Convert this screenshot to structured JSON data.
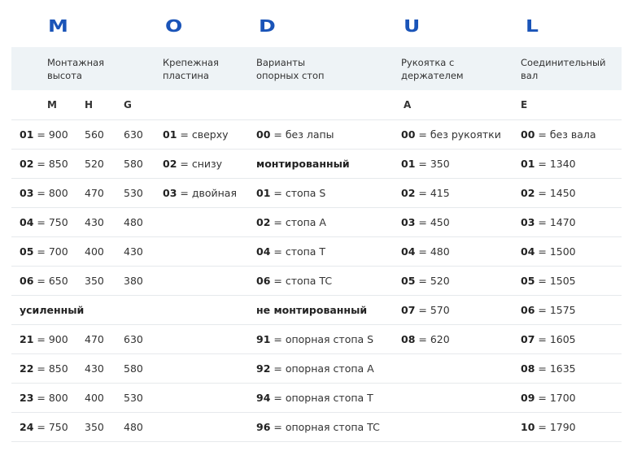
{
  "brand": {
    "letters": [
      "M",
      "O",
      "D",
      "U",
      "L"
    ],
    "color": "#1a54b8"
  },
  "headers": {
    "col1": "Монтажная высота",
    "col2": "Крепежная пластина",
    "col3": "Варианты опорных стоп",
    "col4": "Рукоятка с держателем",
    "col5": "Соединительный вал"
  },
  "subheaders": {
    "m": "M",
    "h": "H",
    "g": "G",
    "a": "A",
    "e": "E"
  },
  "rows": [
    {
      "c1": {
        "code": "01",
        "val": " = 900"
      },
      "h": "560",
      "g": "630",
      "c2": {
        "code": "01",
        "val": " = сверху"
      },
      "c3": {
        "code": "00",
        "val": " = без лапы"
      },
      "c4": {
        "code": "00",
        "val": " = без рукоятки"
      },
      "c5": {
        "code": "00",
        "val": " = без вала"
      }
    },
    {
      "c1": {
        "code": "02",
        "val": " = 850"
      },
      "h": "520",
      "g": "580",
      "c2": {
        "code": "02",
        "val": " = снизу"
      },
      "c3": {
        "code": "монтированный",
        "val": ""
      },
      "c4": {
        "code": "01",
        "val": " = 350"
      },
      "c5": {
        "code": "01",
        "val": " = 1340"
      }
    },
    {
      "c1": {
        "code": "03",
        "val": " = 800"
      },
      "h": "470",
      "g": "530",
      "c2": {
        "code": "03",
        "val": " = двойная"
      },
      "c3": {
        "code": "01",
        "val": " = стопа S"
      },
      "c4": {
        "code": "02",
        "val": " = 415"
      },
      "c5": {
        "code": "02",
        "val": " = 1450"
      }
    },
    {
      "c1": {
        "code": "04",
        "val": " = 750"
      },
      "h": "430",
      "g": "480",
      "c2": {
        "code": "",
        "val": ""
      },
      "c3": {
        "code": "02",
        "val": " = стопа A"
      },
      "c4": {
        "code": "03",
        "val": " = 450"
      },
      "c5": {
        "code": "03",
        "val": " = 1470"
      }
    },
    {
      "c1": {
        "code": "05",
        "val": " = 700"
      },
      "h": "400",
      "g": "430",
      "c2": {
        "code": "",
        "val": ""
      },
      "c3": {
        "code": "04",
        "val": " = стопа T"
      },
      "c4": {
        "code": "04",
        "val": " = 480"
      },
      "c5": {
        "code": "04",
        "val": " = 1500"
      }
    },
    {
      "c1": {
        "code": "06",
        "val": " = 650"
      },
      "h": "350",
      "g": "380",
      "c2": {
        "code": "",
        "val": ""
      },
      "c3": {
        "code": "06",
        "val": " = стопа TC"
      },
      "c4": {
        "code": "05",
        "val": " = 520"
      },
      "c5": {
        "code": "05",
        "val": " = 1505"
      }
    },
    {
      "c1": {
        "code": "усиленный",
        "val": ""
      },
      "h": "",
      "g": "",
      "c2": {
        "code": "",
        "val": ""
      },
      "c3": {
        "code": "не монтированный",
        "val": ""
      },
      "c4": {
        "code": "07",
        "val": " = 570"
      },
      "c5": {
        "code": "06",
        "val": " = 1575"
      }
    },
    {
      "c1": {
        "code": "21",
        "val": " = 900"
      },
      "h": "470",
      "g": "630",
      "c2": {
        "code": "",
        "val": ""
      },
      "c3": {
        "code": "91",
        "val": " = опорная стопа S"
      },
      "c4": {
        "code": "08",
        "val": " = 620"
      },
      "c5": {
        "code": "07",
        "val": " = 1605"
      }
    },
    {
      "c1": {
        "code": "22",
        "val": " = 850"
      },
      "h": "430",
      "g": "580",
      "c2": {
        "code": "",
        "val": ""
      },
      "c3": {
        "code": "92",
        "val": " = опорная стопа A"
      },
      "c4": {
        "code": "",
        "val": ""
      },
      "c5": {
        "code": "08",
        "val": " = 1635"
      }
    },
    {
      "c1": {
        "code": "23",
        "val": " = 800"
      },
      "h": "400",
      "g": "530",
      "c2": {
        "code": "",
        "val": ""
      },
      "c3": {
        "code": "94",
        "val": " = опорная стопа T"
      },
      "c4": {
        "code": "",
        "val": ""
      },
      "c5": {
        "code": "09",
        "val": " = 1700"
      }
    },
    {
      "c1": {
        "code": "24",
        "val": " = 750"
      },
      "h": "350",
      "g": "480",
      "c2": {
        "code": "",
        "val": ""
      },
      "c3": {
        "code": "96",
        "val": " = опорная стопа TC"
      },
      "c4": {
        "code": "",
        "val": ""
      },
      "c5": {
        "code": "10",
        "val": " = 1790"
      }
    }
  ]
}
